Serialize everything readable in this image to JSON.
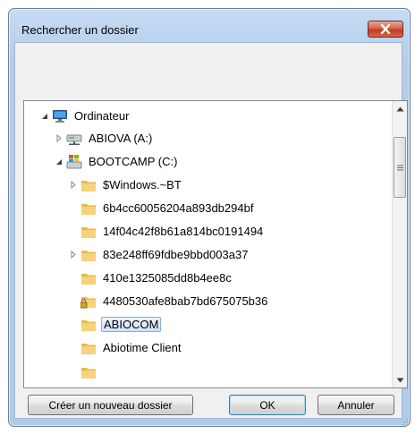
{
  "window": {
    "title": "Rechercher un dossier"
  },
  "tree": {
    "items": [
      {
        "label": "Ordinateur",
        "icon": "computer-icon",
        "expander": "expanded"
      },
      {
        "label": "ABIOVA (A:)",
        "icon": "network-drive-icon",
        "expander": "collapsed"
      },
      {
        "label": "BOOTCAMP (C:)",
        "icon": "windows-drive-icon",
        "expander": "expanded"
      },
      {
        "label": "$Windows.~BT",
        "icon": "folder-icon",
        "expander": "collapsed"
      },
      {
        "label": "6b4cc60056204a893db294bf",
        "icon": "folder-icon",
        "expander": "none"
      },
      {
        "label": "14f04c42f8b61a814bc0191494",
        "icon": "folder-icon",
        "expander": "none"
      },
      {
        "label": "83e248ff69fdbe9bbd003a37",
        "icon": "folder-icon",
        "expander": "collapsed"
      },
      {
        "label": "410e1325085dd8b4ee8c",
        "icon": "folder-icon",
        "expander": "none"
      },
      {
        "label": "4480530afe8bab7bd675075b36",
        "icon": "locked-folder-icon",
        "expander": "none"
      },
      {
        "label": "ABIOCOM",
        "icon": "folder-icon",
        "expander": "none",
        "selected": true
      },
      {
        "label": "Abiotime Client",
        "icon": "folder-icon",
        "expander": "none"
      }
    ]
  },
  "buttons": {
    "new_folder": "Créer un nouveau dossier",
    "ok": "OK",
    "cancel": "Annuler"
  },
  "colors": {
    "selection": "#cfe4fa",
    "close_button": "#c23a22",
    "title_gradient": "#bcd4ef"
  }
}
